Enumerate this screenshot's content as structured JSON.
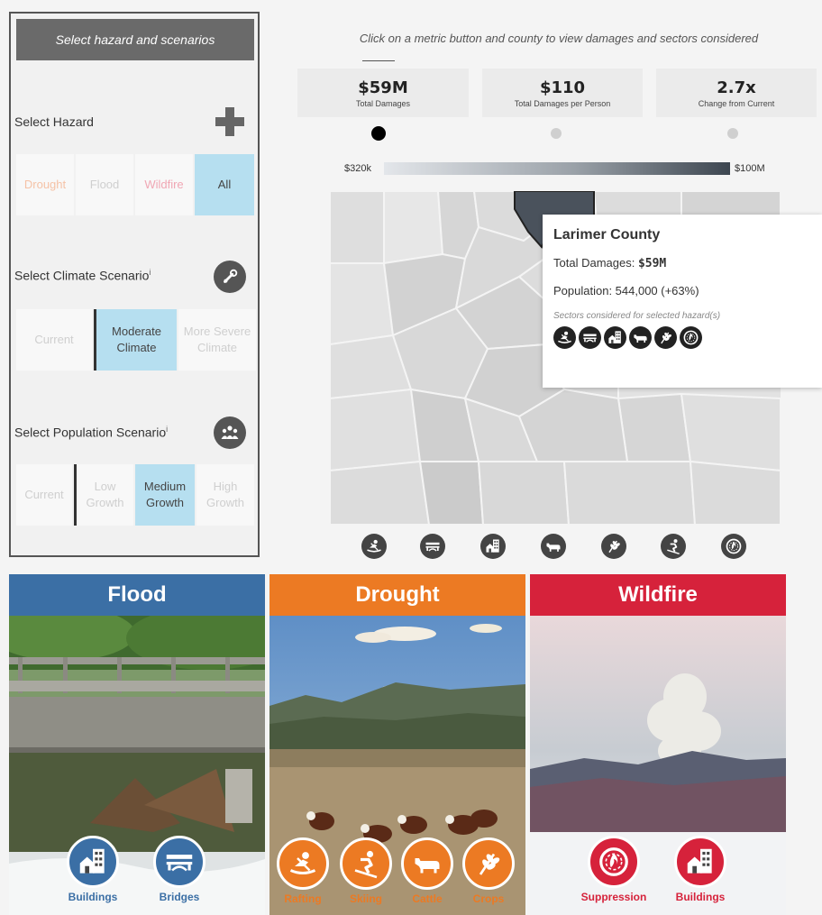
{
  "panel": {
    "header": "Select hazard and scenarios",
    "hazard": {
      "label": "Select Hazard",
      "icon": "plus-icon",
      "options": [
        "Drought",
        "Flood",
        "Wildfire",
        "All"
      ],
      "selected": "All"
    },
    "climate": {
      "label": "Select Climate Scenario",
      "info": "i",
      "icon": "wrench-icon",
      "options": [
        "Current",
        "Moderate Climate",
        "More Severe Climate"
      ],
      "selected": "Moderate Climate"
    },
    "population": {
      "label": "Select Population Scenario",
      "info": "i",
      "icon": "people-icon",
      "options": [
        "Current",
        "Low Growth",
        "Medium Growth",
        "High Growth"
      ],
      "selected": "Medium Growth"
    }
  },
  "main": {
    "instructions": "Click on a metric button and county to view damages and sectors considered",
    "metrics": [
      {
        "value": "$59M",
        "label": "Total Damages",
        "active": true
      },
      {
        "value": "$110",
        "label": "Total Damages per Person",
        "active": false
      },
      {
        "value": "2.7x",
        "label": "Change from Current",
        "active": false
      }
    ],
    "legend": {
      "min": "$320k",
      "max": "$100M"
    },
    "tooltip": {
      "title": "Larimer County",
      "damages_label": "Total Damages: ",
      "damages_value": "$59M",
      "population": "Population: 544,000 (+63%)",
      "sectors_label": "Sectors considered for selected hazard(s)",
      "sector_icons": [
        "rafting-icon",
        "bridges-icon",
        "buildings-icon",
        "cattle-icon",
        "crops-icon",
        "suppression-icon"
      ]
    },
    "sector_icons": [
      "rafting-icon",
      "bridges-icon",
      "buildings-icon",
      "cattle-icon",
      "crops-icon",
      "skiing-icon",
      "suppression-icon"
    ]
  },
  "cards": {
    "flood": {
      "title": "Flood",
      "color": "#3b6fa5",
      "buttons": [
        "Buildings",
        "Bridges"
      ]
    },
    "drought": {
      "title": "Drought",
      "color": "#ec7a23",
      "buttons": [
        "Rafting",
        "Skiing",
        "Cattle",
        "Crops"
      ]
    },
    "wildfire": {
      "title": "Wildfire",
      "color": "#d6223b",
      "buttons": [
        "Suppression",
        "Buildings"
      ]
    }
  },
  "colors": {
    "selected_option": "#b6dff0",
    "panel_header": "#6a6a6a",
    "legend_low": "#e3e6ea",
    "legend_high": "#3d4650"
  }
}
